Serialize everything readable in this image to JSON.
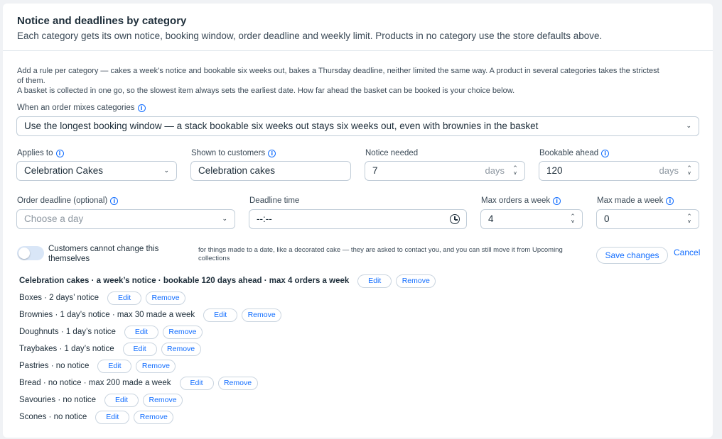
{
  "header": {
    "title": "Notice and deadlines by category",
    "subtitle": "Each category gets its own notice, booking window, order deadline and weekly limit. Products in no category use the store defaults above."
  },
  "help": {
    "line1": "Add a rule per category — cakes a week’s notice and bookable six weeks out, bakes a Thursday deadline, neither limited the same way. A product in several categories takes the strictest",
    "line1b": "of them.",
    "line2": "A basket is collected in one go, so the slowest item always sets the earliest date. How far ahead the basket can be booked is your choice below."
  },
  "mix": {
    "label": "When an order mixes categories",
    "value": "Use the longest booking window — a stack bookable six weeks out stays six weeks out, even with brownies in the basket"
  },
  "form": {
    "applies_to": {
      "label": "Applies to",
      "value": "Celebration Cakes"
    },
    "shown_to": {
      "label": "Shown to customers",
      "value": "Celebration cakes"
    },
    "notice": {
      "label": "Notice needed",
      "value": "7",
      "unit": "days"
    },
    "bookable": {
      "label": "Bookable ahead",
      "value": "120",
      "unit": "days"
    },
    "deadline": {
      "label": "Order deadline (optional)",
      "placeholder": "Choose a day"
    },
    "deadline_time": {
      "label": "Deadline time",
      "value": "--:--"
    },
    "max_orders": {
      "label": "Max orders a week",
      "value": "4"
    },
    "max_made": {
      "label": "Max made a week",
      "value": "0"
    }
  },
  "toggle": {
    "label": "Customers cannot change this themselves",
    "on": false,
    "hint": "for things made to a date, like a decorated cake — they are asked to contact you, and you can still move it from Upcoming collections"
  },
  "actions": {
    "save": "Save changes",
    "cancel": "Cancel"
  },
  "rules": [
    {
      "text": "Celebration cakes · a week’s notice · bookable 120 days ahead · max 4 orders a week",
      "bold": true
    },
    {
      "text": "Boxes · 2 days’ notice"
    },
    {
      "text": "Brownies · 1 day’s notice · max 30 made a week"
    },
    {
      "text": "Doughnuts · 1 day’s notice"
    },
    {
      "text": "Traybakes · 1 day’s notice"
    },
    {
      "text": "Pastries · no notice"
    },
    {
      "text": "Bread · no notice · max 200 made a week"
    },
    {
      "text": "Savouries · no notice"
    },
    {
      "text": "Scones · no notice"
    }
  ],
  "rule_buttons": {
    "edit": "Edit",
    "remove": "Remove"
  },
  "colors": {
    "accent": "#116dff",
    "text": "#20303c",
    "border": "#c1cdd8",
    "page": "#f0f2f5"
  }
}
